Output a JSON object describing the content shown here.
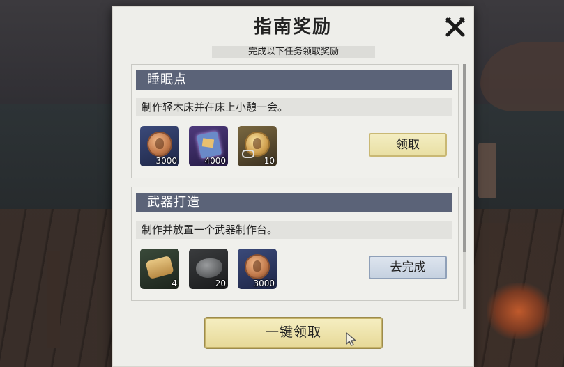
{
  "dialog": {
    "title": "指南奖励",
    "subtitle": "完成以下任务领取奖励",
    "close_icon": "close-icon"
  },
  "tasks": [
    {
      "name": "睡眠点",
      "description": "制作轻木床并在床上小憩一会。",
      "rewards": [
        {
          "icon": "copper-coin-icon",
          "amount": "3000"
        },
        {
          "icon": "experience-book-icon",
          "amount": "4000"
        },
        {
          "icon": "bound-gold-coin-icon",
          "amount": "10"
        }
      ],
      "action": "领取",
      "action_color": "#e8dea2"
    },
    {
      "name": "武器打造",
      "description": "制作并放置一个武器制作台。",
      "rewards": [
        {
          "icon": "scroll-material-icon",
          "amount": "4"
        },
        {
          "icon": "stone-icon",
          "amount": "20"
        },
        {
          "icon": "copper-coin-icon",
          "amount": "3000"
        }
      ],
      "action": "去完成",
      "action_color": "#c4d0df"
    }
  ],
  "footer": {
    "claim_all": "一键领取",
    "cursor_icon": "mouse-cursor-icon"
  },
  "colors": {
    "header_bar": "#5b6378",
    "panel_bg": "#eeeeea",
    "claim_button": "#e6d897"
  }
}
